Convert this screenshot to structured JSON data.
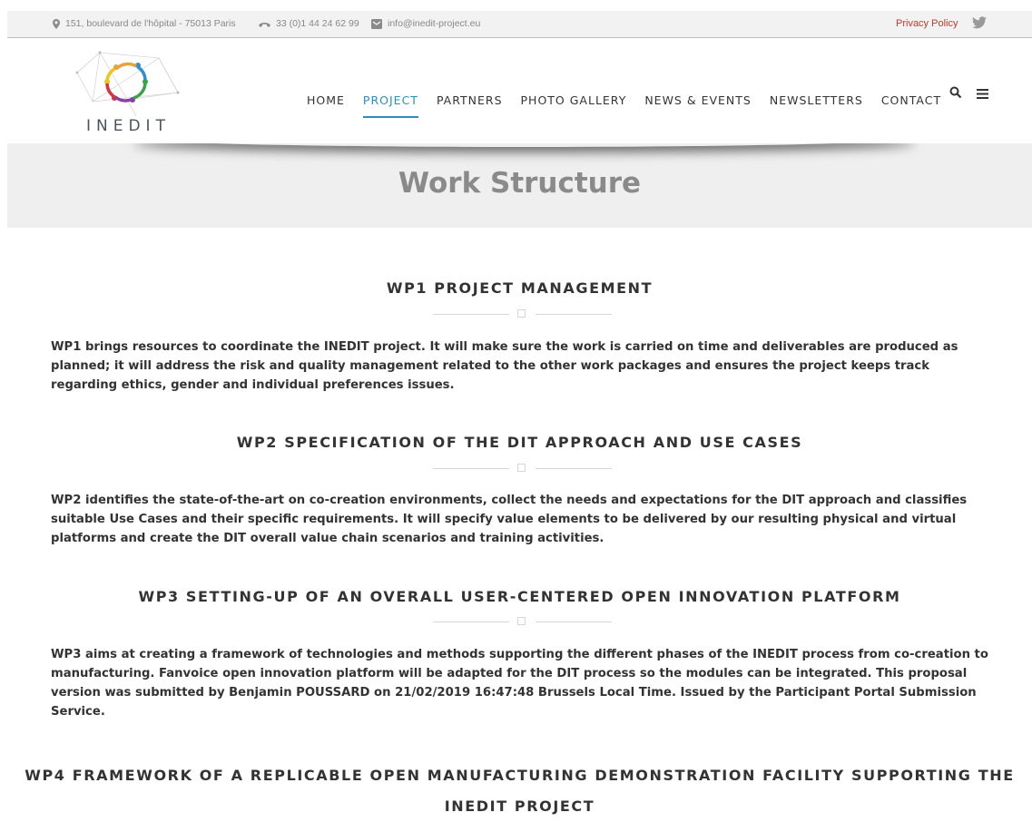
{
  "topbar": {
    "address": "151, boulevard de l'hôpital - 75013 Paris",
    "phone": "33 (0)1 44 24 62 99",
    "email": "info@inedit-project.eu",
    "privacy": "Privacy Policy"
  },
  "logo": {
    "text": "INEDIT"
  },
  "nav": {
    "items": [
      {
        "label": "HOME"
      },
      {
        "label": "PROJECT"
      },
      {
        "label": "PARTNERS"
      },
      {
        "label": "PHOTO GALLERY"
      },
      {
        "label": "NEWS & EVENTS"
      },
      {
        "label": "NEWSLETTERS"
      },
      {
        "label": "CONTACT"
      }
    ],
    "active": "PROJECT"
  },
  "page_title": "Work Structure",
  "sections": [
    {
      "title": "WP1 PROJECT MANAGEMENT",
      "body": "WP1 brings resources to coordinate the INEDIT project. It will make sure the work is carried on time and deliverables are produced as planned; it will address the risk and quality management related to the other work packages and ensures the project keeps track regarding ethics, gender and individual preferences issues."
    },
    {
      "title": "WP2 SPECIFICATION OF THE DIT APPROACH AND USE CASES",
      "body": "WP2 identifies the state-of-the-art on co-creation environments, collect the needs and expectations for the DIT approach and classifies suitable Use Cases and their specific requirements. It will specify value elements to be delivered by our resulting physical and virtual platforms and create the DIT overall value chain scenarios and training activities."
    },
    {
      "title": "WP3 SETTING-UP OF AN OVERALL USER-CENTERED OPEN INNOVATION PLATFORM",
      "body": "WP3 aims at creating a framework of technologies and methods supporting the different phases of the INEDIT process from co-creation to manufacturing. Fanvoice open innovation platform will be adapted for the DIT process so the modules can be integrated. This proposal version was submitted by Benjamin POUSSARD on 21/02/2019 16:47:48 Brussels Local Time. Issued by the Participant Portal Submission Service."
    },
    {
      "title": "WP4 FRAMEWORK OF A REPLICABLE OPEN MANUFACTURING DEMONSTRATION FACILITY SUPPORTING THE INEDIT PROJECT",
      "body": ""
    }
  ],
  "colors": {
    "accent": "#2a8fbd",
    "privacy_link": "#c0392b",
    "title_gray": "#8a8a8a"
  }
}
